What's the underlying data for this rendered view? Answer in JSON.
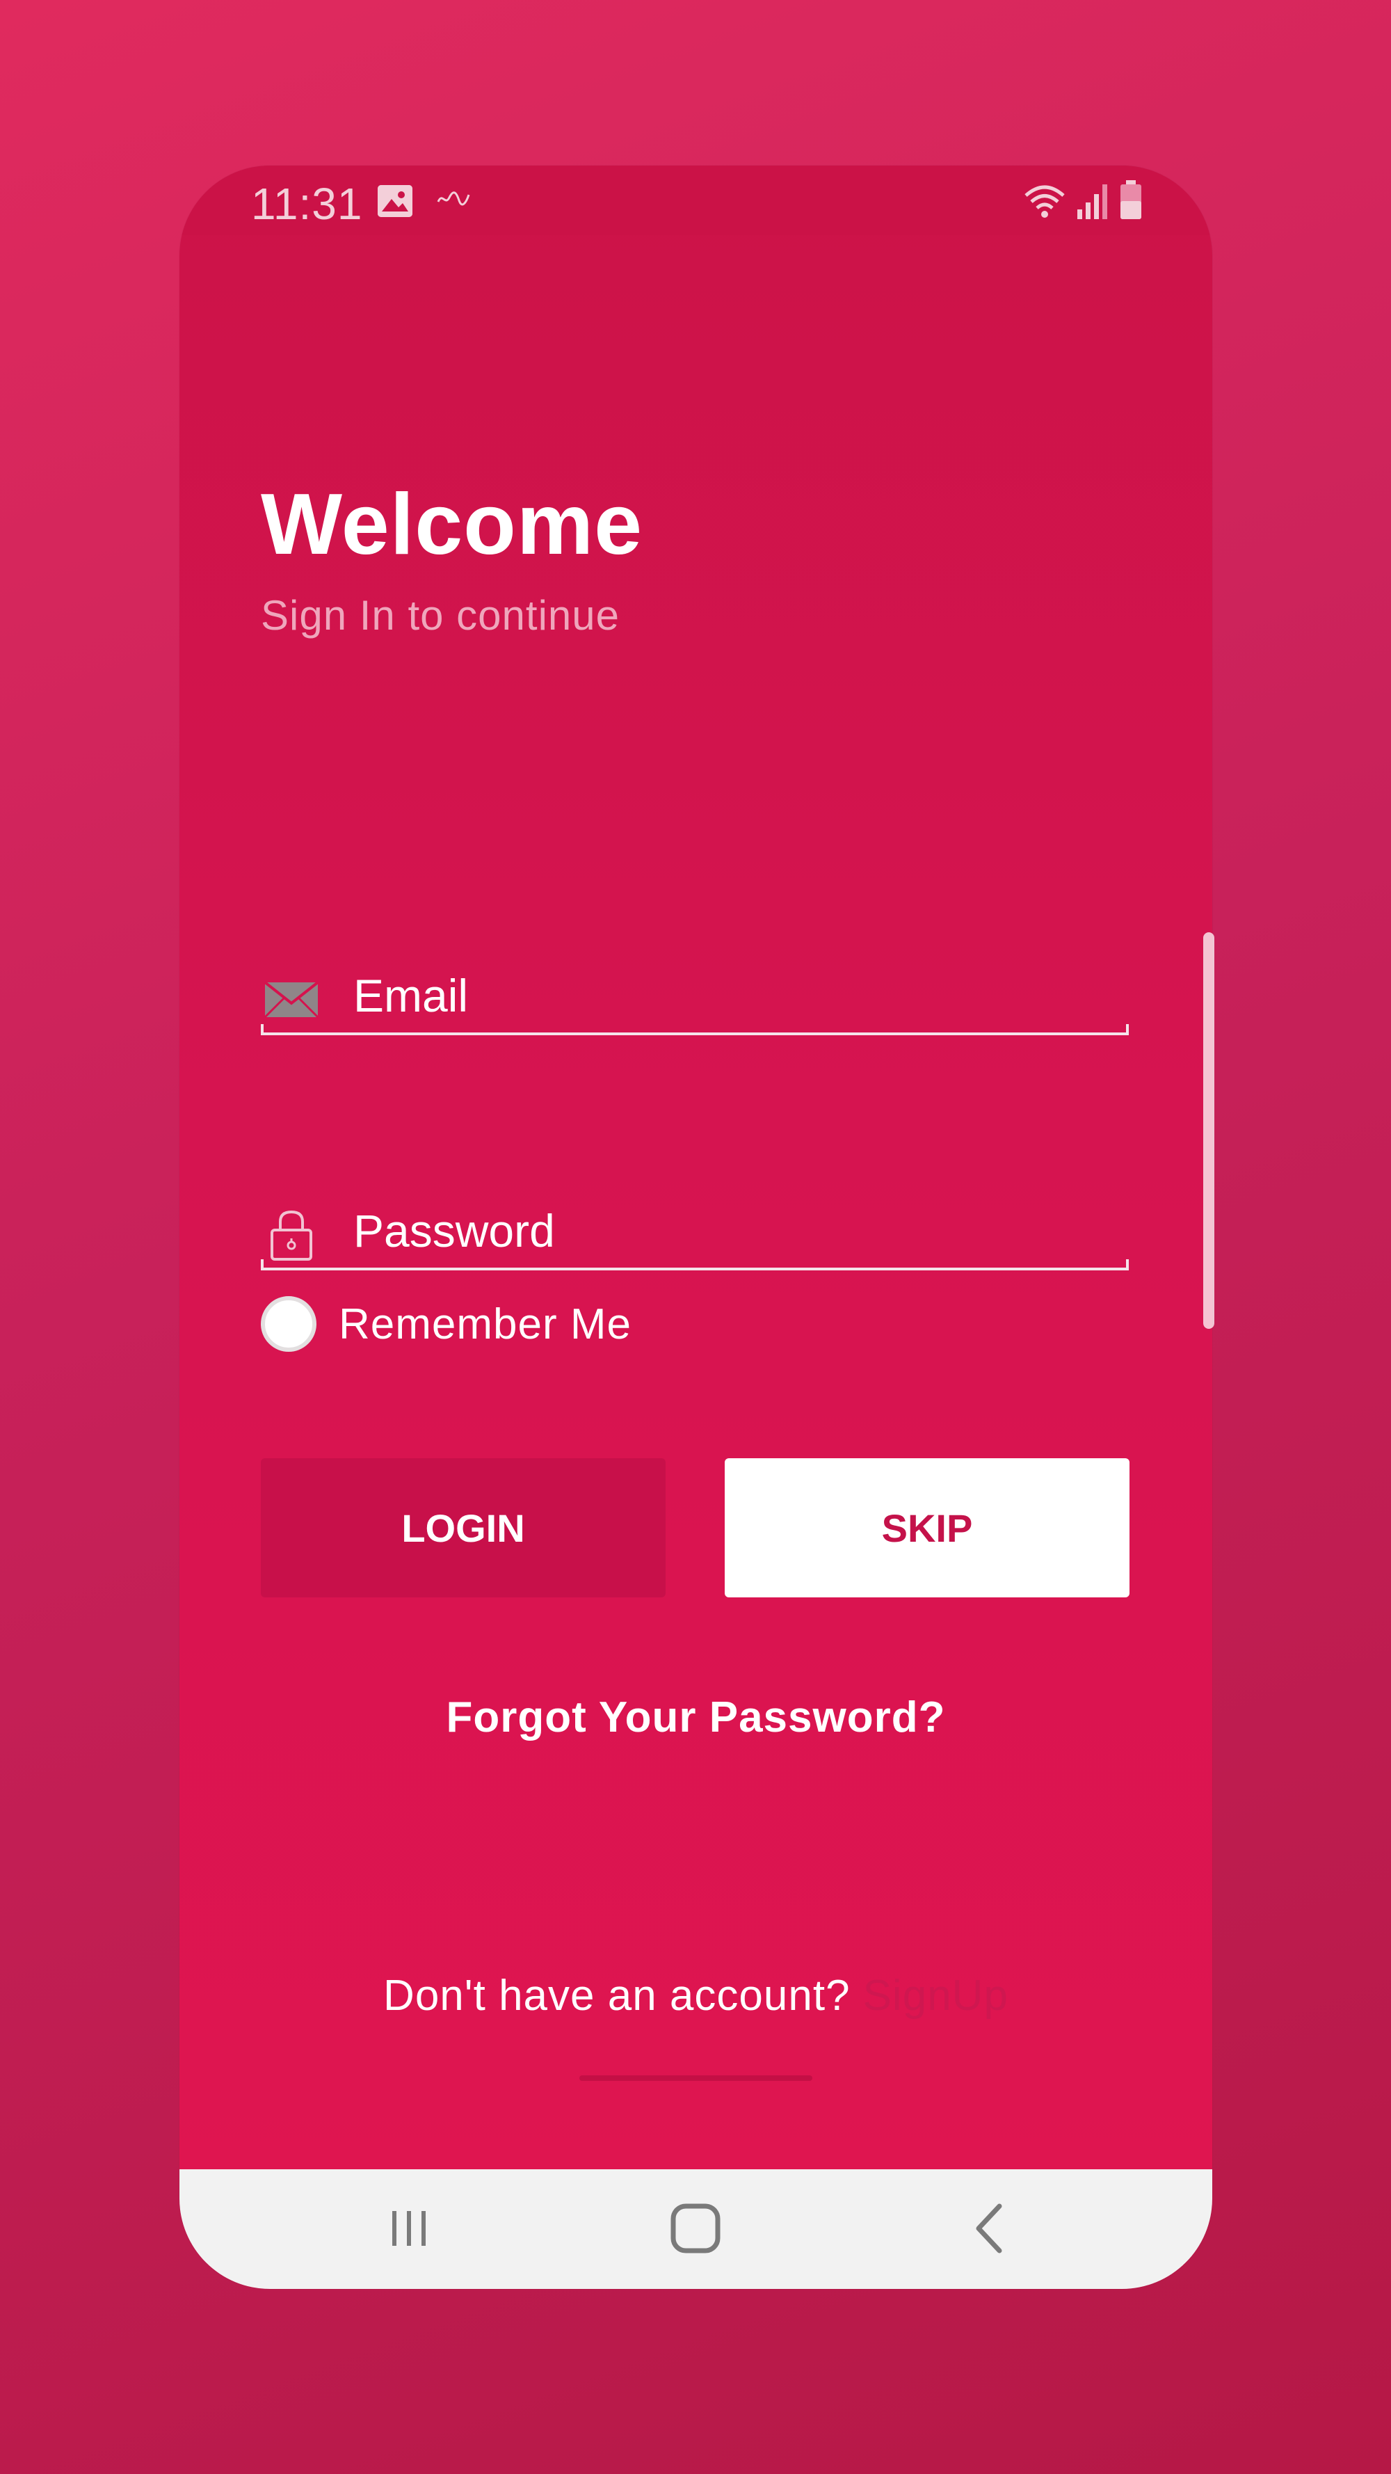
{
  "status_bar": {
    "time": "11:31",
    "icons": [
      "gallery-icon",
      "notification-icon",
      "wifi-icon",
      "signal-icon",
      "battery-icon"
    ]
  },
  "login": {
    "title": "Welcome",
    "subtitle": "Sign In to continue",
    "email": {
      "placeholder": "Email",
      "value": "",
      "icon": "mail-icon"
    },
    "password": {
      "placeholder": "Password",
      "value": "",
      "icon": "lock-icon"
    },
    "remember_me": {
      "label": "Remember Me",
      "checked": false
    },
    "login_button": "LOGIN",
    "skip_button": "SKIP",
    "forgot_password": "Forgot Your Password?",
    "signup_prompt": "Don't have an account?",
    "signup_link": "SignUp"
  },
  "nav_bar": {
    "icons": [
      "recent-apps-icon",
      "home-icon",
      "back-icon"
    ]
  },
  "colors": {
    "background": "#d6124d",
    "skip_text": "#c4124a",
    "nav_bar": "#f2f2f2",
    "signup_link": "#cf1750"
  }
}
